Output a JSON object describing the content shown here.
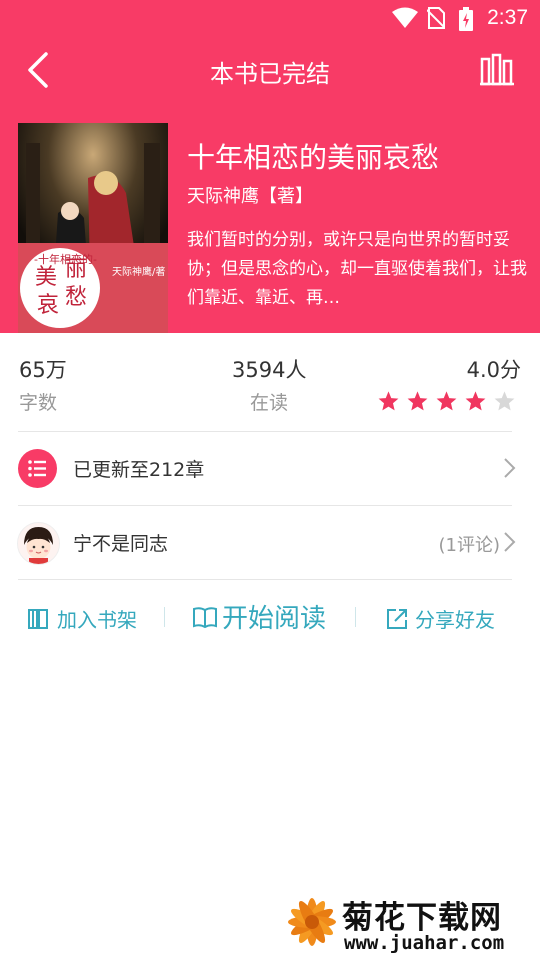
{
  "status_bar": {
    "time": "2:37"
  },
  "header": {
    "title": "本书已完结"
  },
  "book": {
    "cover_small_text": "-十年相恋的-",
    "cover_main_chars": [
      "美",
      "丽",
      "哀",
      "愁"
    ],
    "cover_author_text": "天际神鹰/著",
    "title": "十年相恋的美丽哀愁",
    "author": "天际神鹰【著】",
    "description": "我们暂时的分别，或许只是向世界的暂时妥协；但是思念的心，却一直驱使着我们，让我们靠近、靠近、再…"
  },
  "stats": {
    "words_value": "65万",
    "words_label": "字数",
    "readers_value": "3594人",
    "readers_label": "在读",
    "score_value": "4.0分",
    "rating": 4,
    "rating_max": 5
  },
  "rows": {
    "chapters_label": "已更新至212章",
    "user_name": "宁不是同志",
    "comment_count": "(1评论)"
  },
  "actions": {
    "add_shelf": "加入书架",
    "start_read": "开始阅读",
    "share": "分享好友"
  },
  "watermark": {
    "name": "菊花下载网",
    "url": "www.juahar.com"
  },
  "colors": {
    "primary": "#f83b66",
    "accent": "#35a8bd",
    "star_on": "#f0365f",
    "star_off": "#d8d8d8"
  }
}
